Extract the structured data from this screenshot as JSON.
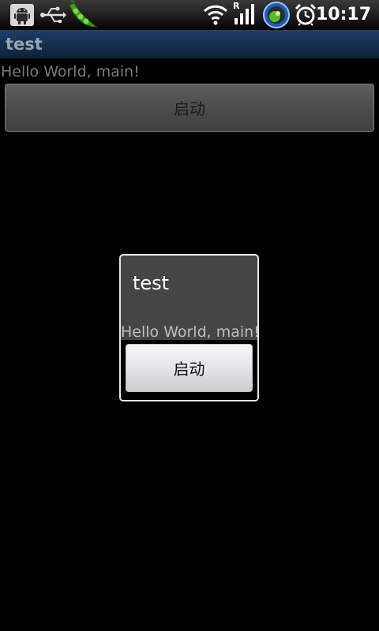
{
  "status_bar": {
    "time": "10:17",
    "icons": [
      "android-debug-icon",
      "usb-icon",
      "pea-pod-icon",
      "wifi-icon",
      "roaming-signal-icon",
      "sync-globe-icon",
      "alarm-clock-icon"
    ],
    "roaming_letter": "R"
  },
  "app": {
    "title": "test",
    "hello_text": "Hello World, main!",
    "start_label": "启动"
  },
  "dialog": {
    "title": "test",
    "hello_text": "Hello World, main!",
    "start_label": "启动"
  }
}
